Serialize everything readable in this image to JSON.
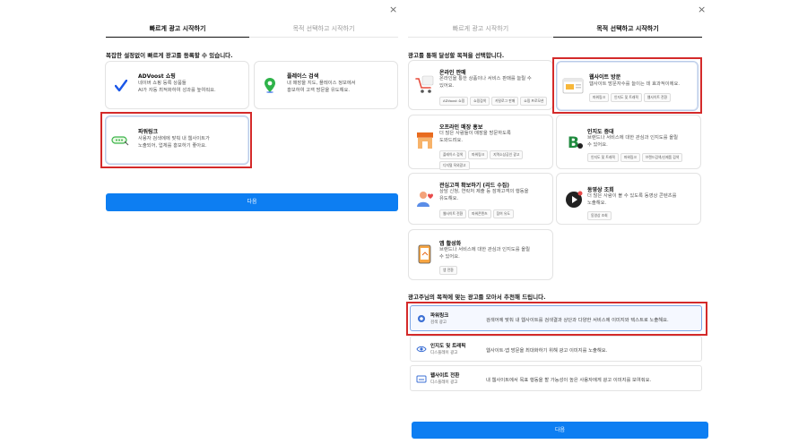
{
  "left": {
    "close": "×",
    "tabs": [
      {
        "label": "빠르게 광고 시작하기"
      },
      {
        "label": "목적 선택하고 시작하기"
      }
    ],
    "heading": "복잡한 설정없이 빠르게 광고를 등록할 수 있습니다.",
    "cards": [
      {
        "title": "ADVoost 쇼핑",
        "desc1": "네이버 쇼핑 등록 상품들",
        "desc2": "AI가 자동 최적화하여 성과를 높여줘요."
      },
      {
        "title": "플레이스 검색",
        "desc1": "내 매장을 지도, 플레이스 정보에서",
        "desc2": "홍보하여 고객 방문을 유도해요."
      },
      {
        "title": "파워링크",
        "desc1": "사용자 검색에에 맞춰 내 웹사이트가",
        "desc2": "노출되어, 업체를 홍보하기 좋아요."
      }
    ],
    "next": "다음"
  },
  "right": {
    "close": "×",
    "tabs": [
      {
        "label": "빠르게 광고 시작하기"
      },
      {
        "label": "목적 선택하고 시작하기"
      }
    ],
    "heading": "광고를 통해 달성할 목적을 선택합니다.",
    "goals": [
      {
        "title": "온라인 판매",
        "desc1": "온라인을 통한 상품이나 서비스 판매를 늘릴 수",
        "desc2": "있어요.",
        "tags": [
          "ADVoost 쇼핑",
          "쇼핑검색",
          "카탈로그 판매",
          "쇼핑 프로모션"
        ]
      },
      {
        "title": "웹사이트 방문",
        "desc1": "웹사이트 방문자수를 늘이는 데 효과적이에요.",
        "desc2": "",
        "tags": [
          "파워링크",
          "인지도 및 트래픽",
          "웹사이트 전환"
        ]
      },
      {
        "title": "오프라인 매장 홍보",
        "desc1": "더 많은 사람들이 매장을 방문하도록",
        "desc2": "도와드려요.",
        "tags": [
          "플레이스 검색",
          "파워링크",
          "지역소상공인 광고",
          "디지털 옥외광고"
        ]
      },
      {
        "title": "인지도 증대",
        "desc1": "브랜드나 서비스에 대한 관심과 인지도를 올릴",
        "desc2": "수 있어요.",
        "tags": [
          "인지도 및 트래픽",
          "파워링크",
          "브랜드검색/신제품 검색"
        ]
      },
      {
        "title": "관심고객 확보하기 (리드 수집)",
        "desc1": "상담 신청, 연락처 제출 등 잠재고객의 행동을",
        "desc2": "유도해요.",
        "tags": [
          "웹사이트 전환",
          "파워콘텐츠",
          "참여 유도"
        ]
      },
      {
        "title": "동영상 조회",
        "desc1": "더 많은 사람이 볼 수 있도록 동영상 콘텐츠를",
        "desc2": "노출해요.",
        "tags": [
          "동영상 조회"
        ]
      },
      {
        "title": "앱 활성화",
        "desc1": "브랜드나 서비스에 대한 관심과 인지도를 올릴",
        "desc2": "수 있어요.",
        "tags": [
          "앱 전환"
        ]
      }
    ],
    "rec_heading": "광고주님의 목적에 맞는 광고를 모아서 추천해 드립니다.",
    "recs": [
      {
        "title": "파워링크",
        "sub": "검색 광고",
        "desc": "검색어에 맞춰 내 웹사이트를 검색결과 상단과 다양한 서비스에 이미지와 텍스트로 노출해요."
      },
      {
        "title": "인지도 및 트래픽",
        "sub": "디스플레이 광고",
        "desc": "웹사이트·앱 방문을 최대화하기 위해 광고 이미지를 노출해요."
      },
      {
        "title": "웹사이트 전환",
        "sub": "디스플레이 광고",
        "desc": "내 웹사이트에서 목표 행동을 할 가능성이 높은 사용자에게 광고 이미지를 보여줘요."
      }
    ],
    "next": "다음"
  }
}
